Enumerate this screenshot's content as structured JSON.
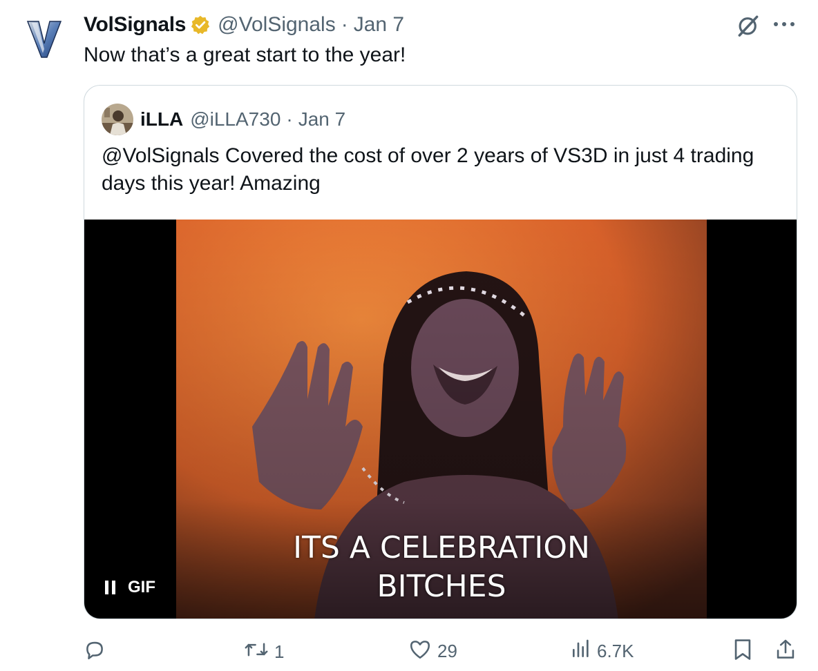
{
  "tweet": {
    "author": {
      "name": "VolSignals",
      "handle": "@VolSignals",
      "verified": true
    },
    "date": "Jan 7",
    "separator": "·",
    "text": "Now that’s a great start to the year!"
  },
  "quote": {
    "author": {
      "name": "iLLA",
      "handle": "@iLLA730"
    },
    "date": "Jan 7",
    "separator": "·",
    "text": "@VolSignals Covered the cost of over 2 years of VS3D in just 4 trading days this year! Amazing",
    "media": {
      "caption_line1": "ITS A CELEBRATION",
      "caption_line2": "BITCHES",
      "badge_label": "GIF"
    }
  },
  "actions": {
    "reposts": "1",
    "likes": "29",
    "views": "6.7K"
  },
  "icons": {
    "reply": "reply-icon",
    "repost": "repost-icon",
    "like": "heart-icon",
    "views": "views-icon",
    "bookmark": "bookmark-icon",
    "share": "share-icon",
    "grok": "grok-icon",
    "more": "more-icon"
  },
  "colors": {
    "text": "#0f1419",
    "muted": "#536471",
    "border": "#cfd9de",
    "verified_gold": "#e8b829"
  }
}
